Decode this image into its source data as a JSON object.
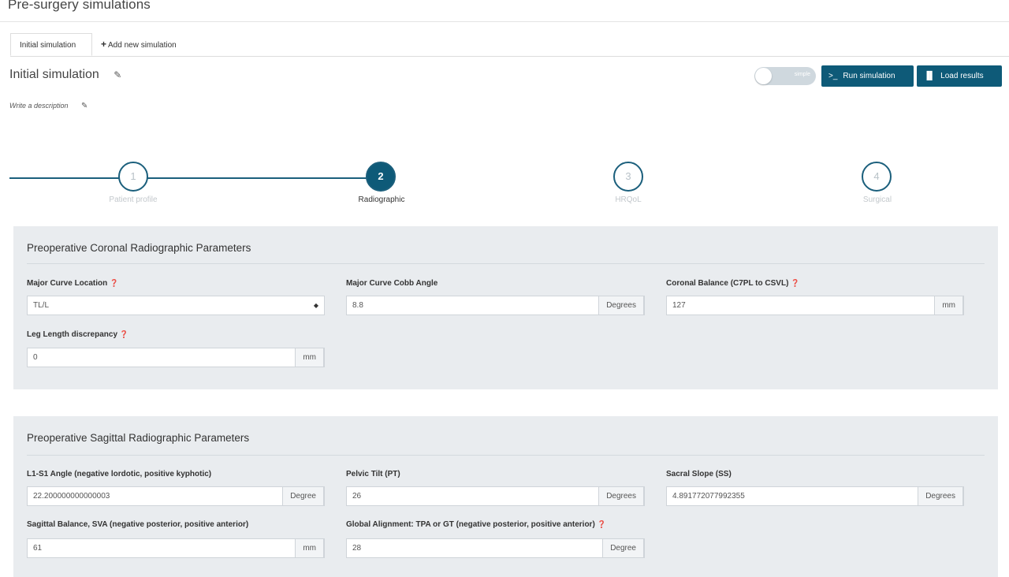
{
  "page_title": "Pre-surgery simulations",
  "tabs": [
    {
      "label": "Initial simulation"
    },
    {
      "label": "Add new simulation"
    }
  ],
  "simulation": {
    "title": "Initial simulation",
    "description_placeholder": "Write a description"
  },
  "toolbar": {
    "toggle_label": "simple",
    "run_label": "Run simulation",
    "load_label": "Load results",
    "accent_color": "#0e5a78"
  },
  "steps": [
    {
      "number": "1",
      "label": "Patient profile"
    },
    {
      "number": "2",
      "label": "Radiographic"
    },
    {
      "number": "3",
      "label": "HRQoL"
    },
    {
      "number": "4",
      "label": "Surgical"
    }
  ],
  "coronal": {
    "heading": "Preoperative Coronal Radiographic Parameters",
    "fields": {
      "major_curve_location": {
        "label": "Major Curve Location",
        "value": "TL/L"
      },
      "major_curve_cobb": {
        "label": "Major Curve Cobb Angle",
        "value": "8.8",
        "unit": "Degrees"
      },
      "coronal_balance": {
        "label": "Coronal Balance (C7PL to CSVL)",
        "value": "127",
        "unit": "mm"
      },
      "leg_length": {
        "label": "Leg Length discrepancy",
        "value": "0",
        "unit": "mm"
      }
    }
  },
  "sagittal": {
    "heading": "Preoperative Sagittal Radiographic Parameters",
    "fields": {
      "l1s1": {
        "label": "L1-S1 Angle (negative lordotic, positive kyphotic)",
        "value": "22.200000000000003",
        "unit": "Degree"
      },
      "pelvic_tilt": {
        "label": "Pelvic Tilt (PT)",
        "value": "26",
        "unit": "Degrees"
      },
      "sacral_slope": {
        "label": "Sacral Slope (SS)",
        "value": "4.891772077992355",
        "unit": "Degrees"
      },
      "sva": {
        "label": "Sagittal Balance, SVA (negative posterior, positive anterior)",
        "value": "61",
        "unit": "mm"
      },
      "global_alignment": {
        "label": "Global Alignment: TPA or GT (negative posterior, positive anterior)",
        "value": "28",
        "unit": "Degree"
      }
    }
  }
}
